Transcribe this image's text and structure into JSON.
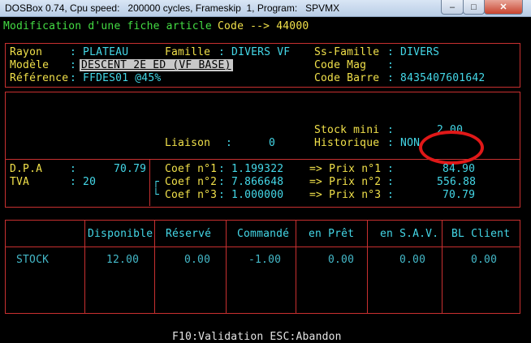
{
  "window": {
    "title": "DOSBox 0.74, Cpu speed:   200000 cycles, Frameskip  1, Program:   SPVMX",
    "min_label": "–",
    "max_label": "□",
    "close_label": "✕"
  },
  "header": {
    "title": "Modification d'une fiche article",
    "code_label": "Code --> 44000"
  },
  "info": {
    "rayon_label": "Rayon",
    "rayon_value": ": PLATEAU",
    "famille_label": "Famille",
    "famille_value": ": DIVERS VF",
    "ssfamille_label": "Ss-Famille",
    "ssfamille_value": ": DIVERS",
    "modele_label": "Modèle",
    "modele_colon": ":",
    "modele_value": "DESCENT 2E ED (VF BASE)",
    "codemag_label": "Code Mag",
    "codemag_value": ":",
    "reference_label": "Référence",
    "reference_value": ": FFDES01 @45%",
    "codebarre_label": "Code Barre",
    "codebarre_value": ": 8435407601642"
  },
  "stock_section": {
    "stockmini_label": "Stock mini",
    "stockmini_colon": ":",
    "stockmini_value": "2.00",
    "liaison_label": "Liaison",
    "liaison_colon": ":",
    "liaison_value": "0",
    "historique_label": "Historique",
    "historique_value": ": NON"
  },
  "pricing": {
    "dpa_label": "D.P.A",
    "dpa_colon": ":",
    "dpa_value": "70.79",
    "tva_label": "TVA",
    "tva_value": ": 20",
    "coefs": [
      {
        "label": "Coef n°1",
        "value": ": 1.199322",
        "prix_label": "=> Prix n°1",
        "prix_colon": ":",
        "prix_value": "84.90"
      },
      {
        "label": "Coef n°2",
        "value": ": 7.866648",
        "prix_label": "=> Prix n°2",
        "prix_colon": ":",
        "prix_value": "556.88"
      },
      {
        "label": "Coef n°3",
        "value": ": 1.000000",
        "prix_label": "=> Prix n°3",
        "prix_colon": ":",
        "prix_value": "70.79"
      }
    ]
  },
  "stock_table": {
    "headers": [
      "Disponible",
      "Réservé",
      "Commandé",
      "en Prêt",
      "en S.A.V.",
      "BL Client"
    ],
    "row_label": "STOCK",
    "row_values": [
      "12.00",
      "0.00",
      "-1.00",
      "0.00",
      "0.00",
      "0.00"
    ]
  },
  "footer": {
    "text": "F10:Validation ESC:Abandon"
  }
}
